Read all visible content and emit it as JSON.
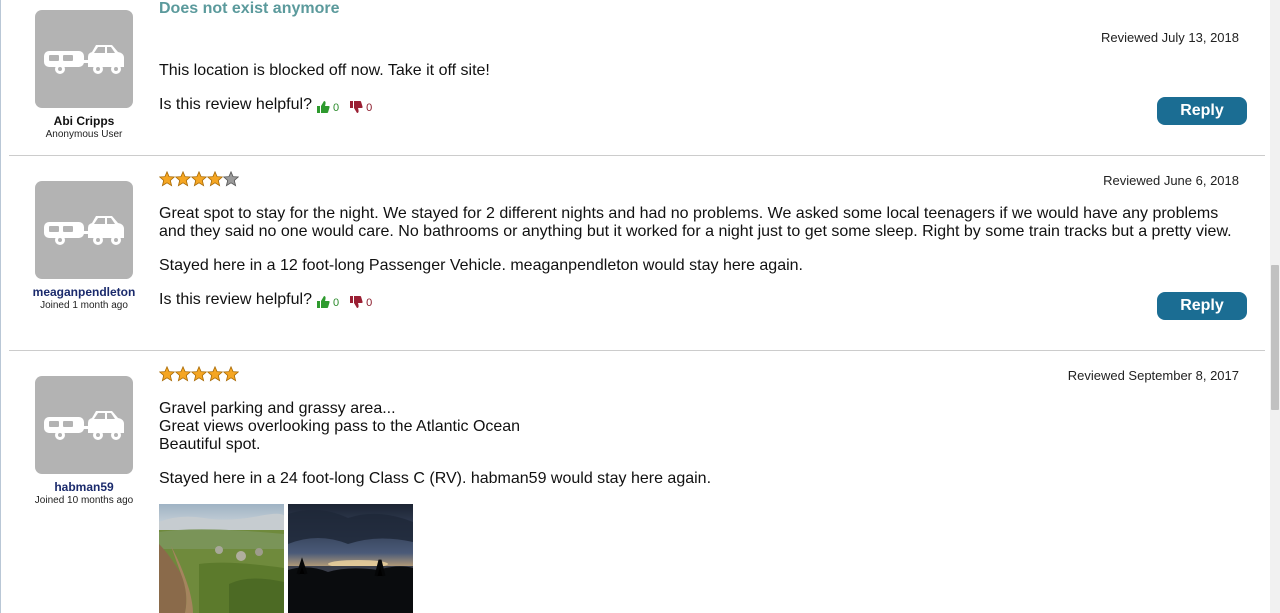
{
  "reviews": [
    {
      "user": "Abi Cripps",
      "user_sub": "Anonymous User",
      "title": "Does not exist anymore",
      "date": "Reviewed July 13, 2018",
      "body_lines": [
        "This location is blocked off now. Take it off site!"
      ],
      "stay_text": "",
      "helpful_label": "Is this review helpful?",
      "up_count": "0",
      "down_count": "0",
      "reply_label": "Reply",
      "rating": null
    },
    {
      "user": "meaganpendleton",
      "user_sub": "Joined 1 month ago",
      "title": "",
      "date": "Reviewed June 6, 2018",
      "body_lines": [
        "Great spot to stay for the night. We stayed for 2 different nights and had no problems. We asked some local teenagers if we would have any problems",
        "and they said no one would care. No bathrooms or anything but it worked for a night just to get some sleep. Right by some train tracks but a pretty view."
      ],
      "stay_text": "Stayed here in a 12 foot-long Passenger Vehicle. meaganpendleton would stay here again.",
      "helpful_label": "Is this review helpful?",
      "up_count": "0",
      "down_count": "0",
      "reply_label": "Reply",
      "rating": 4
    },
    {
      "user": "habman59",
      "user_sub": "Joined 10 months ago",
      "title": "",
      "date": "Reviewed September 8, 2017",
      "body_lines": [
        "Gravel parking and grassy area...",
        "Great views overlooking pass to the Atlantic Ocean",
        "Beautiful spot."
      ],
      "stay_text": "Stayed here in a 24 foot-long Class C (RV). habman59 would stay here again.",
      "rating": 5
    }
  ],
  "icons": {
    "avatar": "rv-trailer-icon",
    "up": "thumbs-up-icon",
    "down": "thumbs-down-icon",
    "star": "star-icon"
  },
  "colors": {
    "reply_button": "#1b6d93",
    "title": "#5b9a9c",
    "avatar_bg": "#b3b3b3",
    "star_filled": "#f5a623",
    "star_empty": "#8a8a8a"
  }
}
